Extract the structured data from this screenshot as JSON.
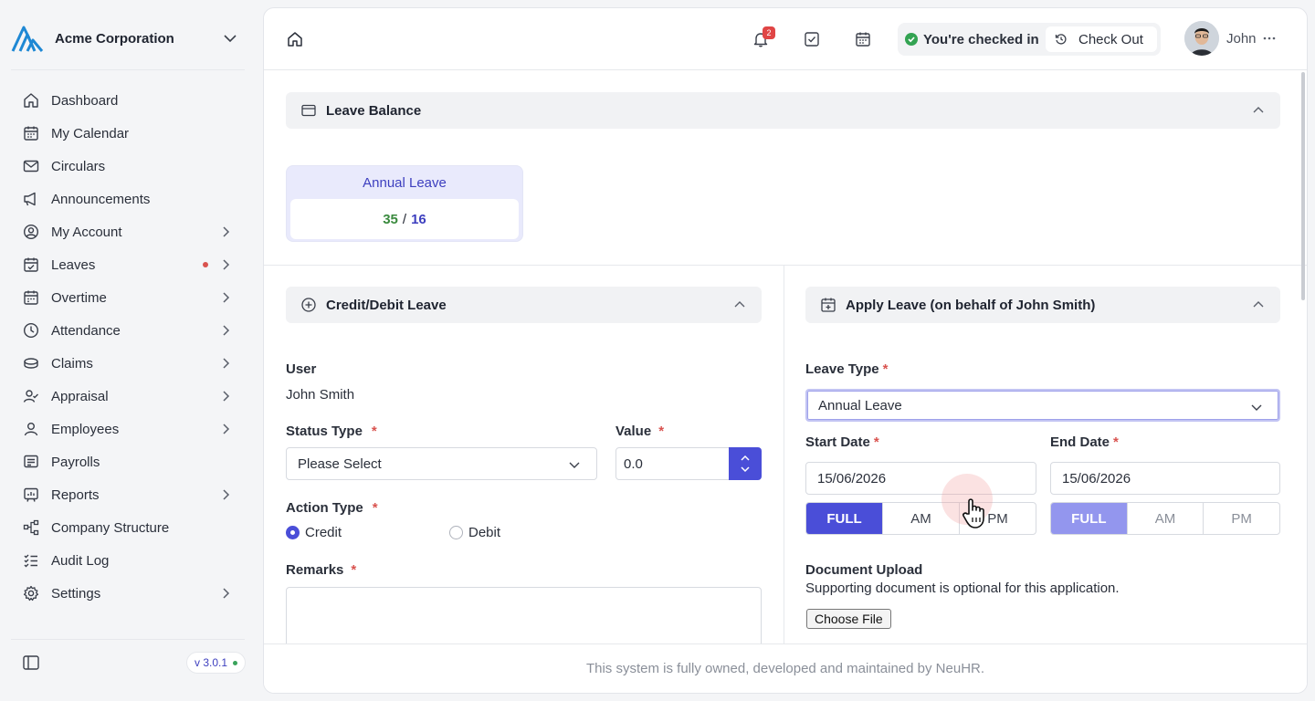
{
  "org": {
    "name": "Acme Corporation"
  },
  "sidebar": {
    "items": [
      {
        "label": "Dashboard",
        "icon": "home-icon",
        "has_chevron": false
      },
      {
        "label": "My Calendar",
        "icon": "calendar-icon",
        "has_chevron": false
      },
      {
        "label": "Circulars",
        "icon": "mail-icon",
        "has_chevron": false
      },
      {
        "label": "Announcements",
        "icon": "megaphone-icon",
        "has_chevron": false
      },
      {
        "label": "My Account",
        "icon": "user-circle-icon",
        "has_chevron": true
      },
      {
        "label": "Leaves",
        "icon": "calendar-check-icon",
        "has_chevron": true,
        "has_dot": true
      },
      {
        "label": "Overtime",
        "icon": "calendar-clock-icon",
        "has_chevron": true
      },
      {
        "label": "Attendance",
        "icon": "clock-icon",
        "has_chevron": true
      },
      {
        "label": "Claims",
        "icon": "coins-icon",
        "has_chevron": true
      },
      {
        "label": "Appraisal",
        "icon": "user-check-icon",
        "has_chevron": true
      },
      {
        "label": "Employees",
        "icon": "user-icon",
        "has_chevron": true
      },
      {
        "label": "Payrolls",
        "icon": "payslip-icon",
        "has_chevron": false
      },
      {
        "label": "Reports",
        "icon": "report-icon",
        "has_chevron": true
      },
      {
        "label": "Company Structure",
        "icon": "org-chart-icon",
        "has_chevron": false
      },
      {
        "label": "Audit Log",
        "icon": "list-check-icon",
        "has_chevron": false
      },
      {
        "label": "Settings",
        "icon": "gear-icon",
        "has_chevron": true
      }
    ],
    "version": "v 3.0.1"
  },
  "topbar": {
    "notification_count": "2",
    "checkin_status": "You're checked in",
    "checkout_label": "Check Out",
    "user_name": "John"
  },
  "leave_balance": {
    "title": "Leave Balance",
    "cards": [
      {
        "name": "Annual Leave",
        "used": "35",
        "separator": "/",
        "total": "16"
      }
    ]
  },
  "credit_debit": {
    "title": "Credit/Debit Leave",
    "user_label": "User",
    "user_value": "John Smith",
    "status_type_label": "Status Type",
    "status_type_value": "Please Select",
    "value_label": "Value",
    "value_value": "0.0",
    "action_type_label": "Action Type",
    "action_options": [
      "Credit",
      "Debit"
    ],
    "action_selected": "Credit",
    "remarks_label": "Remarks"
  },
  "apply_leave": {
    "title": "Apply Leave (on behalf of John Smith)",
    "leave_type_label": "Leave Type",
    "leave_type_value": "Annual Leave",
    "start_date_label": "Start Date",
    "start_date_value": "15/06/2026",
    "end_date_label": "End Date",
    "end_date_value": "15/06/2026",
    "start_segments": [
      "FULL",
      "AM",
      "PM"
    ],
    "end_segments": [
      "FULL",
      "AM",
      "PM"
    ],
    "doc_label": "Document Upload",
    "doc_hint": "Supporting document is optional for this application.",
    "file_button": "Choose File"
  },
  "required_mark": "*",
  "footer": {
    "text": "This system is fully owned, developed and maintained by NeuHR."
  },
  "colors": {
    "accent": "#4a4ed8",
    "success": "#33a352",
    "danger": "#d9534f"
  }
}
